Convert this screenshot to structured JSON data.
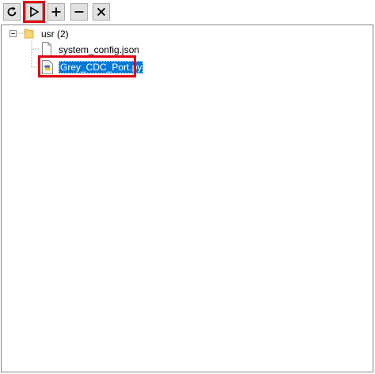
{
  "toolbar": {
    "buttons": [
      {
        "name": "refresh",
        "icon": "refresh-icon"
      },
      {
        "name": "run",
        "icon": "play-icon",
        "highlighted": true
      },
      {
        "name": "add",
        "icon": "plus-icon"
      },
      {
        "name": "remove",
        "icon": "minus-icon"
      },
      {
        "name": "close",
        "icon": "close-icon"
      }
    ]
  },
  "tree": {
    "root": {
      "label": "usr (2)",
      "icon": "folder-icon",
      "expanded": true,
      "children": [
        {
          "label": "system_config.json",
          "icon": "file-icon",
          "selected": false
        },
        {
          "label": "Grey_CDC_Port.py",
          "icon": "python-file-icon",
          "selected": true,
          "highlighted": true
        }
      ]
    }
  },
  "colors": {
    "highlight": "#e0000f",
    "selection": "#0078d7",
    "folder": "#f7d774",
    "button_face": "#e1e1e1"
  }
}
